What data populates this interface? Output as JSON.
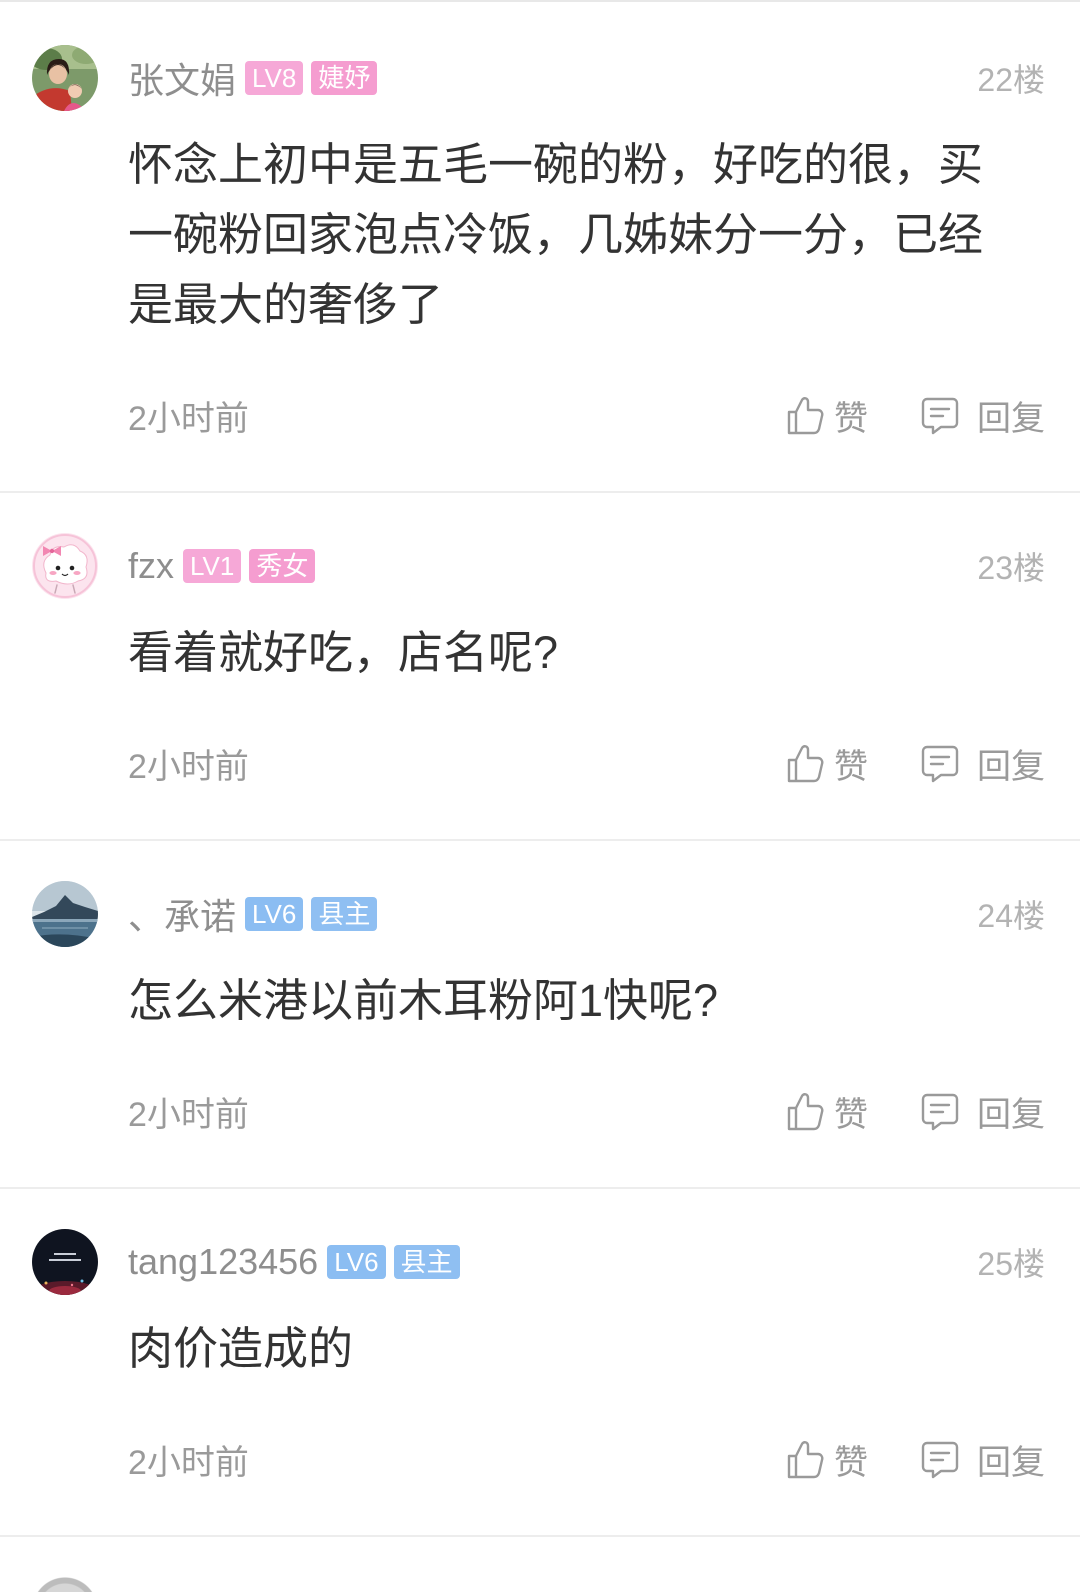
{
  "actions": {
    "like": "赞",
    "reply": "回复"
  },
  "icons": {
    "like": "thumbs-up-icon",
    "reply": "comment-bubble-icon"
  },
  "colors": {
    "text": "#333333",
    "meta": "#9a9a9a",
    "divider": "#ededed"
  },
  "comments": [
    {
      "user_name": "张文娟",
      "badges": [
        {
          "label": "LV8",
          "color": "#f6a8d7"
        },
        {
          "label": "婕妤",
          "color": "#f59dd0"
        }
      ],
      "floor": "22楼",
      "content": "怀念上初中是五毛一碗的粉，好吃的很，买一碗粉回家泡点冷饭，几姊妹分一分，已经是最大的奢侈了",
      "time": "2小时前"
    },
    {
      "user_name": "fzx",
      "badges": [
        {
          "label": "LV1",
          "color": "#f6a8d7"
        },
        {
          "label": "秀女",
          "color": "#f59dd0"
        }
      ],
      "floor": "23楼",
      "content": "看着就好吃，店名呢?",
      "time": "2小时前"
    },
    {
      "user_name": "、承诺",
      "badges": [
        {
          "label": "LV6",
          "color": "#8bbdf2"
        },
        {
          "label": "县主",
          "color": "#8fbff2"
        }
      ],
      "floor": "24楼",
      "content": "怎么米港以前木耳粉阿1快呢?",
      "time": "2小时前"
    },
    {
      "user_name": "tang123456",
      "badges": [
        {
          "label": "LV6",
          "color": "#8bbdf2"
        },
        {
          "label": "县主",
          "color": "#8fbff2"
        }
      ],
      "floor": "25楼",
      "content": "肉价造成的",
      "time": "2小时前"
    }
  ]
}
